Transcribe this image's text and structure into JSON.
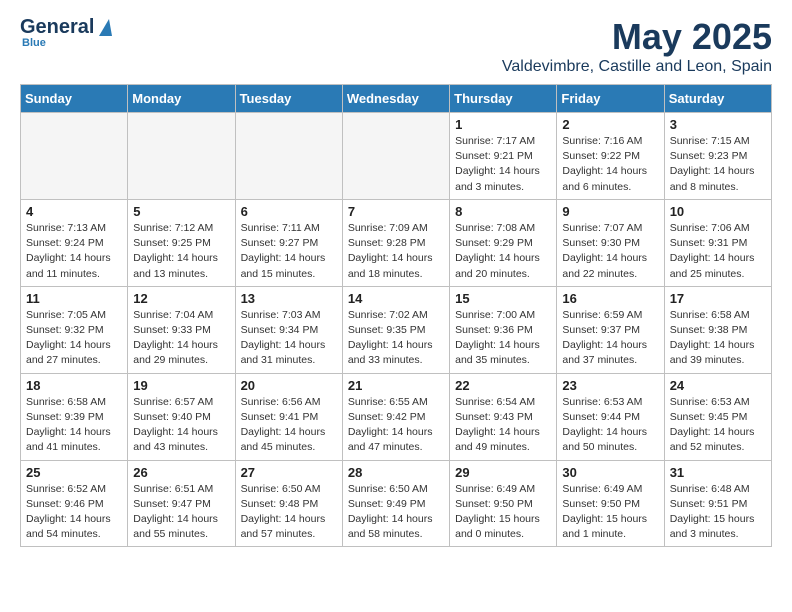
{
  "logo": {
    "general": "General",
    "blue": "Blue"
  },
  "title": "May 2025",
  "location": "Valdevimbre, Castille and Leon, Spain",
  "days_of_week": [
    "Sunday",
    "Monday",
    "Tuesday",
    "Wednesday",
    "Thursday",
    "Friday",
    "Saturday"
  ],
  "weeks": [
    [
      {
        "day": "",
        "empty": true
      },
      {
        "day": "",
        "empty": true
      },
      {
        "day": "",
        "empty": true
      },
      {
        "day": "",
        "empty": true
      },
      {
        "day": "1",
        "sunrise": "Sunrise: 7:17 AM",
        "sunset": "Sunset: 9:21 PM",
        "daylight": "Daylight: 14 hours and 3 minutes."
      },
      {
        "day": "2",
        "sunrise": "Sunrise: 7:16 AM",
        "sunset": "Sunset: 9:22 PM",
        "daylight": "Daylight: 14 hours and 6 minutes."
      },
      {
        "day": "3",
        "sunrise": "Sunrise: 7:15 AM",
        "sunset": "Sunset: 9:23 PM",
        "daylight": "Daylight: 14 hours and 8 minutes."
      }
    ],
    [
      {
        "day": "4",
        "sunrise": "Sunrise: 7:13 AM",
        "sunset": "Sunset: 9:24 PM",
        "daylight": "Daylight: 14 hours and 11 minutes."
      },
      {
        "day": "5",
        "sunrise": "Sunrise: 7:12 AM",
        "sunset": "Sunset: 9:25 PM",
        "daylight": "Daylight: 14 hours and 13 minutes."
      },
      {
        "day": "6",
        "sunrise": "Sunrise: 7:11 AM",
        "sunset": "Sunset: 9:27 PM",
        "daylight": "Daylight: 14 hours and 15 minutes."
      },
      {
        "day": "7",
        "sunrise": "Sunrise: 7:09 AM",
        "sunset": "Sunset: 9:28 PM",
        "daylight": "Daylight: 14 hours and 18 minutes."
      },
      {
        "day": "8",
        "sunrise": "Sunrise: 7:08 AM",
        "sunset": "Sunset: 9:29 PM",
        "daylight": "Daylight: 14 hours and 20 minutes."
      },
      {
        "day": "9",
        "sunrise": "Sunrise: 7:07 AM",
        "sunset": "Sunset: 9:30 PM",
        "daylight": "Daylight: 14 hours and 22 minutes."
      },
      {
        "day": "10",
        "sunrise": "Sunrise: 7:06 AM",
        "sunset": "Sunset: 9:31 PM",
        "daylight": "Daylight: 14 hours and 25 minutes."
      }
    ],
    [
      {
        "day": "11",
        "sunrise": "Sunrise: 7:05 AM",
        "sunset": "Sunset: 9:32 PM",
        "daylight": "Daylight: 14 hours and 27 minutes."
      },
      {
        "day": "12",
        "sunrise": "Sunrise: 7:04 AM",
        "sunset": "Sunset: 9:33 PM",
        "daylight": "Daylight: 14 hours and 29 minutes."
      },
      {
        "day": "13",
        "sunrise": "Sunrise: 7:03 AM",
        "sunset": "Sunset: 9:34 PM",
        "daylight": "Daylight: 14 hours and 31 minutes."
      },
      {
        "day": "14",
        "sunrise": "Sunrise: 7:02 AM",
        "sunset": "Sunset: 9:35 PM",
        "daylight": "Daylight: 14 hours and 33 minutes."
      },
      {
        "day": "15",
        "sunrise": "Sunrise: 7:00 AM",
        "sunset": "Sunset: 9:36 PM",
        "daylight": "Daylight: 14 hours and 35 minutes."
      },
      {
        "day": "16",
        "sunrise": "Sunrise: 6:59 AM",
        "sunset": "Sunset: 9:37 PM",
        "daylight": "Daylight: 14 hours and 37 minutes."
      },
      {
        "day": "17",
        "sunrise": "Sunrise: 6:58 AM",
        "sunset": "Sunset: 9:38 PM",
        "daylight": "Daylight: 14 hours and 39 minutes."
      }
    ],
    [
      {
        "day": "18",
        "sunrise": "Sunrise: 6:58 AM",
        "sunset": "Sunset: 9:39 PM",
        "daylight": "Daylight: 14 hours and 41 minutes."
      },
      {
        "day": "19",
        "sunrise": "Sunrise: 6:57 AM",
        "sunset": "Sunset: 9:40 PM",
        "daylight": "Daylight: 14 hours and 43 minutes."
      },
      {
        "day": "20",
        "sunrise": "Sunrise: 6:56 AM",
        "sunset": "Sunset: 9:41 PM",
        "daylight": "Daylight: 14 hours and 45 minutes."
      },
      {
        "day": "21",
        "sunrise": "Sunrise: 6:55 AM",
        "sunset": "Sunset: 9:42 PM",
        "daylight": "Daylight: 14 hours and 47 minutes."
      },
      {
        "day": "22",
        "sunrise": "Sunrise: 6:54 AM",
        "sunset": "Sunset: 9:43 PM",
        "daylight": "Daylight: 14 hours and 49 minutes."
      },
      {
        "day": "23",
        "sunrise": "Sunrise: 6:53 AM",
        "sunset": "Sunset: 9:44 PM",
        "daylight": "Daylight: 14 hours and 50 minutes."
      },
      {
        "day": "24",
        "sunrise": "Sunrise: 6:53 AM",
        "sunset": "Sunset: 9:45 PM",
        "daylight": "Daylight: 14 hours and 52 minutes."
      }
    ],
    [
      {
        "day": "25",
        "sunrise": "Sunrise: 6:52 AM",
        "sunset": "Sunset: 9:46 PM",
        "daylight": "Daylight: 14 hours and 54 minutes."
      },
      {
        "day": "26",
        "sunrise": "Sunrise: 6:51 AM",
        "sunset": "Sunset: 9:47 PM",
        "daylight": "Daylight: 14 hours and 55 minutes."
      },
      {
        "day": "27",
        "sunrise": "Sunrise: 6:50 AM",
        "sunset": "Sunset: 9:48 PM",
        "daylight": "Daylight: 14 hours and 57 minutes."
      },
      {
        "day": "28",
        "sunrise": "Sunrise: 6:50 AM",
        "sunset": "Sunset: 9:49 PM",
        "daylight": "Daylight: 14 hours and 58 minutes."
      },
      {
        "day": "29",
        "sunrise": "Sunrise: 6:49 AM",
        "sunset": "Sunset: 9:50 PM",
        "daylight": "Daylight: 15 hours and 0 minutes."
      },
      {
        "day": "30",
        "sunrise": "Sunrise: 6:49 AM",
        "sunset": "Sunset: 9:50 PM",
        "daylight": "Daylight: 15 hours and 1 minute."
      },
      {
        "day": "31",
        "sunrise": "Sunrise: 6:48 AM",
        "sunset": "Sunset: 9:51 PM",
        "daylight": "Daylight: 15 hours and 3 minutes."
      }
    ]
  ]
}
